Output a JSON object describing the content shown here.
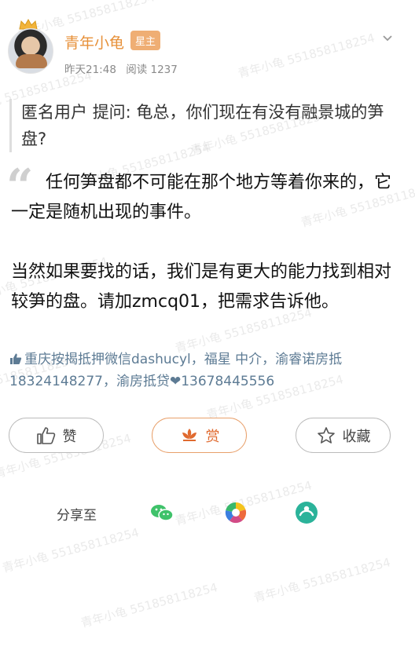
{
  "post": {
    "author": "青年小龟",
    "badge": "星主",
    "time": "昨天21:48",
    "views": "阅读 1237"
  },
  "question": {
    "asker": "匿名用户",
    "text": "提问: 龟总，你们现在有没有融景城的笋盘?"
  },
  "answer": {
    "quote_mark": "“",
    "paragraph1": "任何笋盘都不可能在那个地方等着你来的，它一定是随机出现的事件。",
    "paragraph2": "当然如果要找的话，我们是有更大的能力找到相对较笋的盘。请加zmcq01，把需求告诉他。"
  },
  "ad": {
    "text": "重庆按揭抵押微信dashucyl，福星 中介，渝睿诺房抵18324148277，渝房抵贷❤13678445556"
  },
  "actions": {
    "like": "赞",
    "tip": "赏",
    "favorite": "收藏"
  },
  "share": {
    "label": "分享至",
    "wechat_icon": "wechat-icon",
    "moments_icon": "moments-icon",
    "other_icon": "qzone-icon"
  },
  "watermark": {
    "text": "青年小龟 551858118254"
  },
  "colors": {
    "author": "#e7913a",
    "badge": "#efae74",
    "tip": "#e06a2f",
    "ad": "#5d7b94",
    "wechat": "#3fc26a"
  }
}
